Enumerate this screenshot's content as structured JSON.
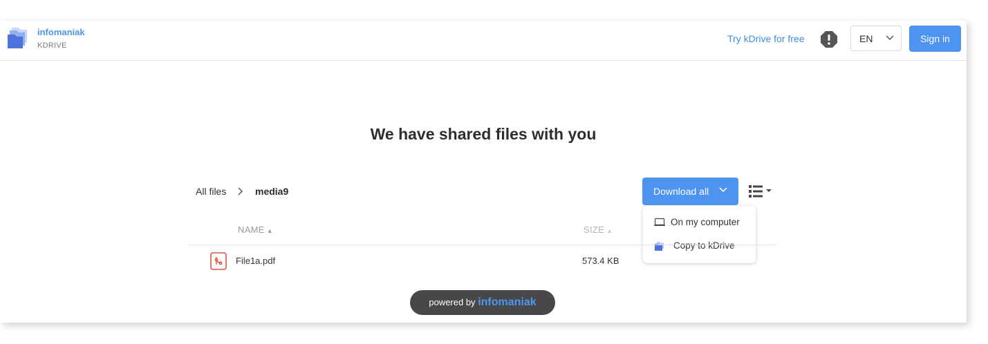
{
  "header": {
    "brand": "infomaniak",
    "product": "KDRIVE",
    "try_link": "Try kDrive for free",
    "language": "EN",
    "sign_in": "Sign in"
  },
  "main": {
    "title": "We have shared files with you",
    "breadcrumb": {
      "root": "All files",
      "current": "media9"
    },
    "download_all": "Download all",
    "download_menu": [
      {
        "label": "On my computer",
        "icon": "laptop-icon"
      },
      {
        "label": "Copy to kDrive",
        "icon": "kdrive-folder-icon"
      }
    ],
    "table": {
      "columns": [
        "NAME",
        "SIZE"
      ],
      "rows": [
        {
          "name": "File1a.pdf",
          "size": "573.4 KB",
          "icon": "pdf-file-icon"
        }
      ]
    }
  },
  "footer": {
    "powered_by": "powered by",
    "brand": "infomaniak"
  },
  "colors": {
    "accent": "#4d94f0",
    "link": "#3f8be2",
    "pdf": "#e0533a",
    "badge": "#484848"
  }
}
